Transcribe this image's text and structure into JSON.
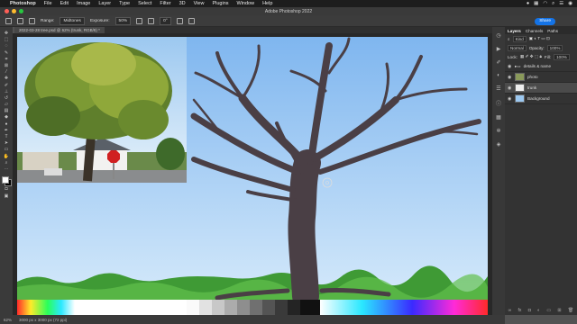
{
  "menubar": {
    "apple_icon": "apple-icon",
    "items": [
      "Photoshop",
      "File",
      "Edit",
      "Image",
      "Layer",
      "Type",
      "Select",
      "Filter",
      "3D",
      "View",
      "Plugins",
      "Window",
      "Help"
    ],
    "status_icons": [
      "record-icon",
      "grid-icon",
      "wifi-icon",
      "search-icon",
      "control-center-icon",
      "siri-icon"
    ]
  },
  "window": {
    "title": "Adobe Photoshop 2022"
  },
  "options": {
    "range_label": "Range:",
    "range_value": "Midtones",
    "exposure_label": "Exposure:",
    "exposure_value": "50%",
    "angle_value": "0°",
    "share_label": "Share"
  },
  "document": {
    "tab_label": "2022-03-28 tree.psd @ 62% (trunk, RGB/8) *"
  },
  "layers_panel": {
    "tabs": [
      "Layers",
      "Channels",
      "Paths"
    ],
    "kind_label": "Kind",
    "blend_mode": "Normal",
    "opacity_label": "Opacity:",
    "opacity_value": "100%",
    "lock_label": "Lock:",
    "fill_label": "Fill:",
    "fill_value": "100%",
    "layers": [
      {
        "name": "details & name",
        "type": "group"
      },
      {
        "name": "photo",
        "type": "image"
      },
      {
        "name": "trunk",
        "type": "image",
        "selected": true
      },
      {
        "name": "Background",
        "type": "image"
      }
    ]
  },
  "status": {
    "zoom": "62%",
    "doc_size": "3000 px x 3000 px (72 ppi)"
  },
  "colors": {
    "sky_top": "#7fb6ef",
    "sky_bottom": "#d9ecfb",
    "trunk": "#4a3f45",
    "grass": "#3f9a35",
    "accent": "#1473e6"
  }
}
